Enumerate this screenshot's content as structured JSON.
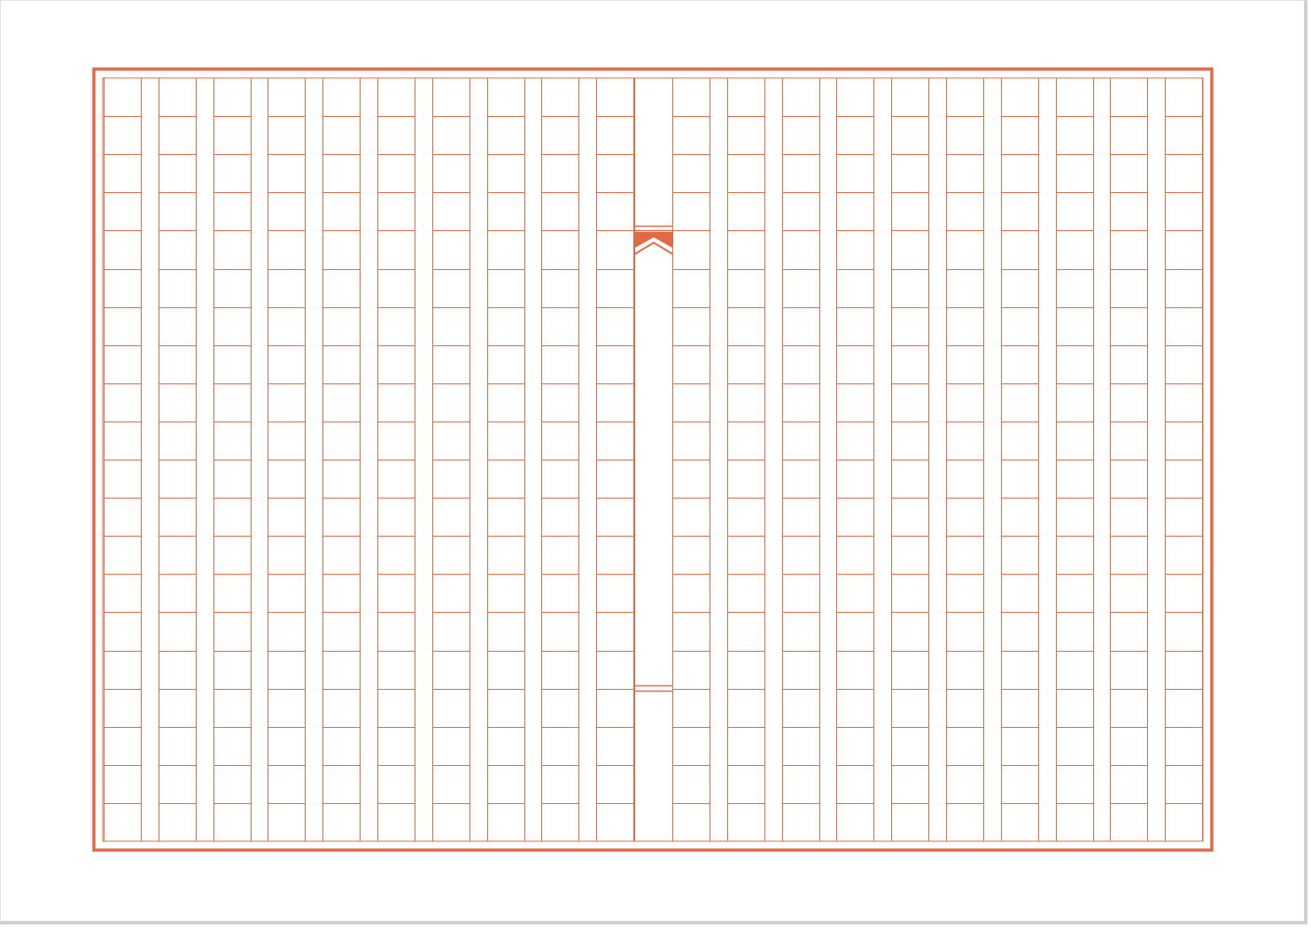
{
  "document": {
    "type": "genkou-youshi-manuscript-paper",
    "columns": 20,
    "rows": 20,
    "accent_color": "#e06a45",
    "background_color": "#ffffff",
    "center_spine_icon": "chevron-up-icon"
  }
}
